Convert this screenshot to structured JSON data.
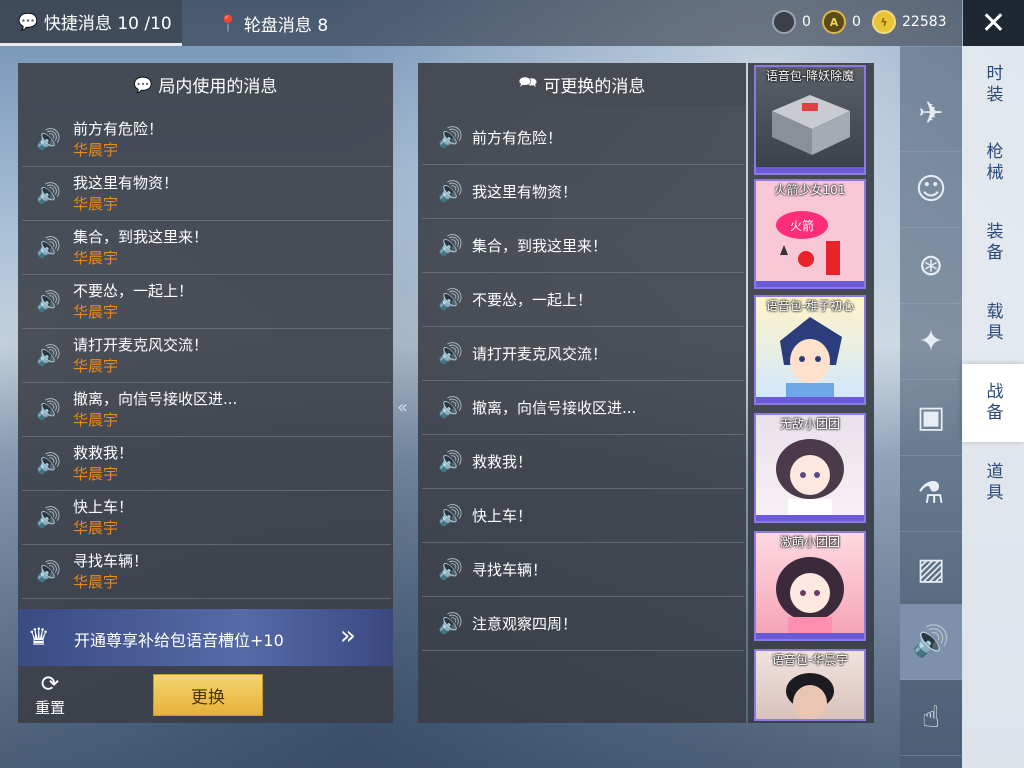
{
  "topbar": {
    "tab_quick": "快捷消息 10 /10",
    "tab_wheel": "轮盘消息 8",
    "currency": [
      "0",
      "0",
      "22583"
    ]
  },
  "left_panel": {
    "title": "局内使用的消息",
    "messages": [
      {
        "text": "前方有危险！",
        "owner": "华晨宇"
      },
      {
        "text": "我这里有物资！",
        "owner": "华晨宇"
      },
      {
        "text": "集合，到我这里来！",
        "owner": "华晨宇"
      },
      {
        "text": "不要怂，一起上！",
        "owner": "华晨宇"
      },
      {
        "text": "请打开麦克风交流！",
        "owner": "华晨宇"
      },
      {
        "text": "撤离，向信号接收区进...",
        "owner": "华晨宇"
      },
      {
        "text": "救救我！",
        "owner": "华晨宇"
      },
      {
        "text": "快上车！",
        "owner": "华晨宇"
      },
      {
        "text": "寻找车辆！",
        "owner": "华晨宇"
      }
    ],
    "vip_banner": "开通尊享补给包语音槽位+10",
    "reset_label": "重置",
    "swap_label": "更换"
  },
  "mid_panel": {
    "title": "可更换的消息",
    "messages": [
      "前方有危险！",
      "我这里有物资！",
      "集合，到我这里来！",
      "不要怂，一起上！",
      "请打开麦克风交流！",
      "撤离，向信号接收区进...",
      "救救我！",
      "快上车！",
      "寻找车辆！",
      "注意观察四周！"
    ]
  },
  "packs": [
    "语音包-降妖除魔",
    "火箭少女101",
    "语音包-稚子初心",
    "无敌小团团",
    "激萌小团团",
    "语音包-华晨宇"
  ],
  "categories": {
    "icons": [
      "crate-icon",
      "plane-icon",
      "face-icon",
      "robot-icon",
      "magic-wand-icon",
      "chat-bubble-icon",
      "spray-can-icon",
      "photos-icon",
      "voice-icon",
      "gesture-icon"
    ],
    "tabs": [
      "时装",
      "枪械",
      "装备",
      "载具",
      "战备",
      "道具"
    ]
  },
  "colors": {
    "owner_name": "#e8891f",
    "vip_banner": "#4a5c96",
    "swap_button": "#f0c95a",
    "selected_tab_text": "#2b4a76"
  }
}
